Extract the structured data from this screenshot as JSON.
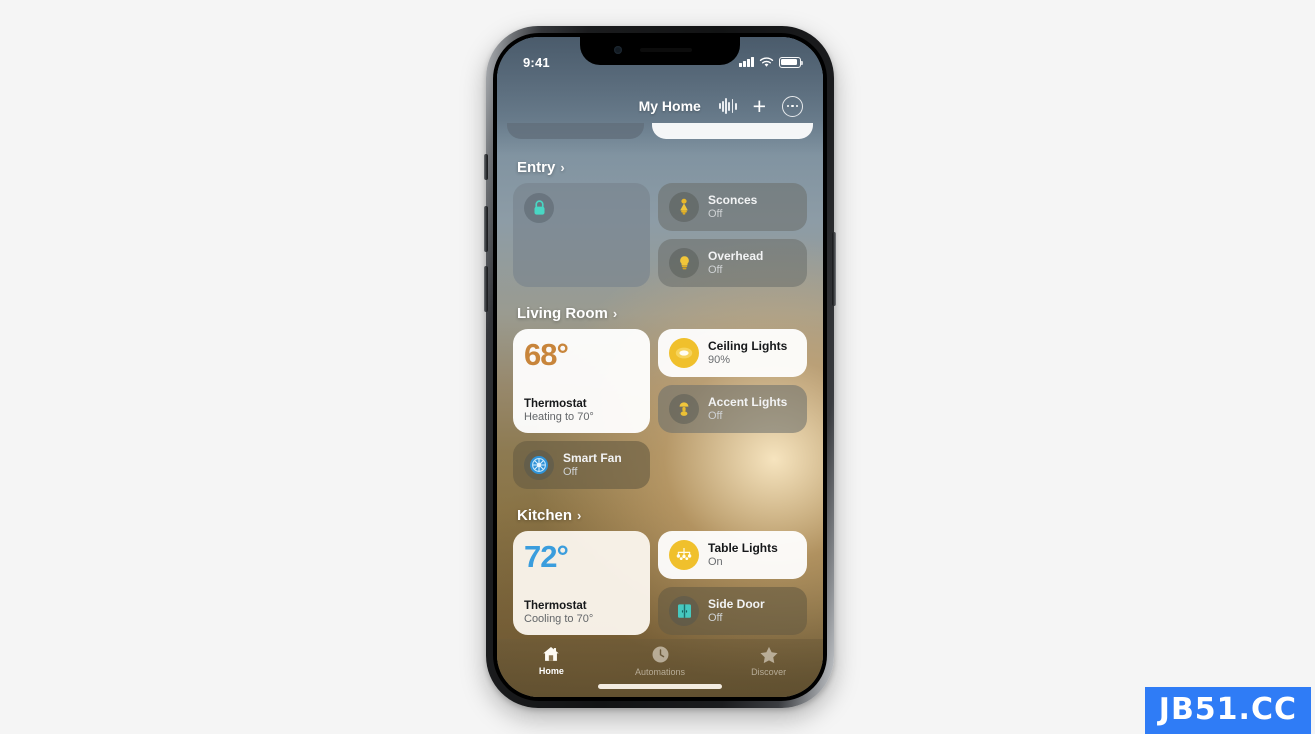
{
  "statusbar": {
    "time": "9:41",
    "signal_icon": "cellular-signal-icon",
    "wifi_icon": "wifi-icon",
    "battery_icon": "battery-icon"
  },
  "navbar": {
    "title": "My Home",
    "siri_icon": "waveform-icon",
    "add_icon": "plus-icon",
    "more_icon": "ellipsis-circle-icon"
  },
  "rooms": [
    {
      "name": "Entry",
      "chevron": "›",
      "big_tile": {
        "type": "lock",
        "icon": "lock-icon",
        "name": "",
        "sub": ""
      },
      "accessories": [
        {
          "name": "Sconces",
          "status": "Off",
          "state": "off",
          "icon": "sconce-lamp-icon"
        },
        {
          "name": "Overhead",
          "status": "Off",
          "state": "off",
          "icon": "bulb-icon"
        }
      ]
    },
    {
      "name": "Living Room",
      "chevron": "›",
      "big_tile": {
        "type": "thermostat",
        "temperature": "68°",
        "temp_mode": "hot",
        "name": "Thermostat",
        "sub": "Heating to 70°"
      },
      "accessories": [
        {
          "name": "Ceiling Lights",
          "status": "90%",
          "state": "on",
          "icon": "ceiling-light-icon"
        },
        {
          "name": "Accent Lights",
          "status": "Off",
          "state": "off",
          "icon": "table-lamp-icon"
        }
      ],
      "extra": {
        "name": "Smart Fan",
        "status": "Off",
        "state": "off-warm",
        "icon": "fan-icon"
      }
    },
    {
      "name": "Kitchen",
      "chevron": "›",
      "big_tile": {
        "type": "thermostat",
        "temperature": "72°",
        "temp_mode": "cold",
        "name": "Thermostat",
        "sub": "Cooling to 70°"
      },
      "accessories": [
        {
          "name": "Table Lights",
          "status": "On",
          "state": "on",
          "icon": "chandelier-icon"
        },
        {
          "name": "Side Door",
          "status": "Off",
          "state": "off-warm",
          "icon": "door-icon"
        }
      ]
    }
  ],
  "tabbar": {
    "tabs": [
      {
        "label": "Home",
        "icon": "house-icon",
        "active": true
      },
      {
        "label": "Automations",
        "icon": "clock-check-icon",
        "active": false
      },
      {
        "label": "Discover",
        "icon": "star-icon",
        "active": false
      }
    ]
  },
  "watermark": {
    "text": "JB51.CC",
    "color": "#2f7cf6"
  },
  "colors": {
    "hot_temp": "#c8853b",
    "cold_temp": "#3a9ddd",
    "accent_yellow": "#f0c02c",
    "lock_teal": "#49d7c4",
    "door_teal": "#46c9c0",
    "fan_blue": "#2f93d8"
  }
}
